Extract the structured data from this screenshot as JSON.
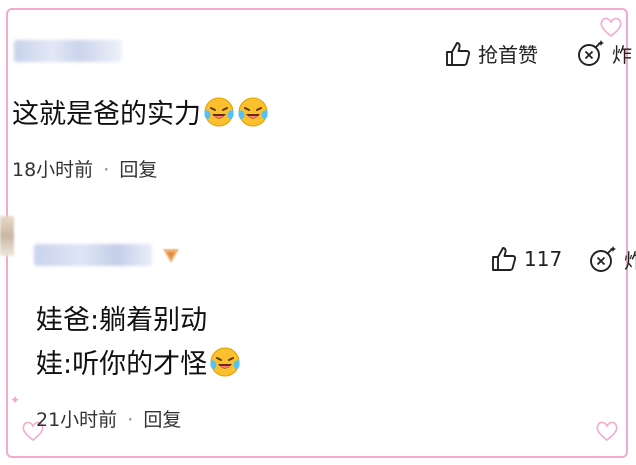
{
  "comments": [
    {
      "username": "",
      "text": "这就是爸的实力",
      "emojis": [
        "laugh-cry-emoji",
        "laugh-cry-emoji"
      ],
      "time": "18小时前",
      "separator": "·",
      "reply": "回复",
      "like_label": "抢首赞",
      "bomb_label": "炸"
    },
    {
      "username": "",
      "lines": [
        "娃爸:躺着别动",
        "娃:听你的才怪"
      ],
      "emojis": [
        "laugh-cry-emoji"
      ],
      "time": "21小时前",
      "separator": "·",
      "reply": "回复",
      "like_count": "117",
      "bomb_label": "炸"
    }
  ],
  "colors": {
    "frame": "#f4a9cf",
    "text": "#111111",
    "meta": "#333333"
  }
}
